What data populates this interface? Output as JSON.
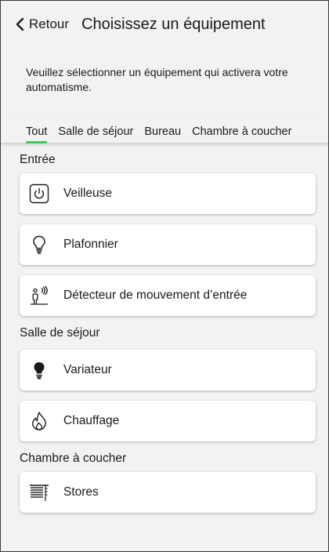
{
  "header": {
    "back_label": "Retour",
    "title": "Choisissez un équipement"
  },
  "description": "Veuillez sélectionner un équipement qui activera votre automatisme.",
  "tabs": [
    {
      "label": "Tout",
      "active": true
    },
    {
      "label": "Salle de séjour",
      "active": false
    },
    {
      "label": "Bureau",
      "active": false
    },
    {
      "label": "Chambre à coucher",
      "active": false
    }
  ],
  "colors": {
    "accent": "#3dcd58",
    "background": "#f2f2f2",
    "card": "#ffffff"
  },
  "sections": [
    {
      "title": "Entrée",
      "devices": [
        {
          "label": "Veilleuse",
          "icon": "power-button-icon"
        },
        {
          "label": "Plafonnier",
          "icon": "light-bulb-icon"
        },
        {
          "label": "Détecteur de mouvement d’entrée",
          "icon": "motion-sensor-icon"
        }
      ]
    },
    {
      "title": "Salle de séjour",
      "devices": [
        {
          "label": "Variateur",
          "icon": "dimmer-bulb-icon"
        },
        {
          "label": "Chauffage",
          "icon": "flame-icon"
        }
      ]
    },
    {
      "title": "Chambre à coucher",
      "devices": [
        {
          "label": "Stores",
          "icon": "blinds-icon"
        }
      ]
    }
  ]
}
